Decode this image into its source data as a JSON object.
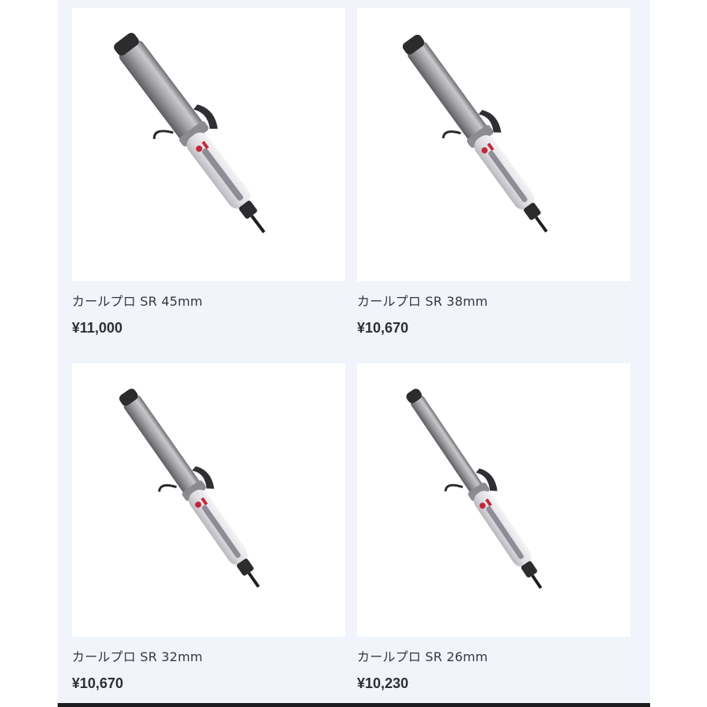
{
  "products": [
    {
      "name": "カールプロ SR 45mm",
      "price": "¥11,000",
      "image": "curling-iron-45mm"
    },
    {
      "name": "カールプロ SR 38mm",
      "price": "¥10,670",
      "image": "curling-iron-38mm"
    },
    {
      "name": "カールプロ SR 32mm",
      "price": "¥10,670",
      "image": "curling-iron-32mm"
    },
    {
      "name": "カールプロ SR 26mm",
      "price": "¥10,230",
      "image": "curling-iron-26mm"
    }
  ],
  "colors": {
    "page_background": "#f1f4fb",
    "card_background": "#ffffff",
    "barrel": "#a9a9ab",
    "handle": "#e6e4e8",
    "accent_red": "#c0283a",
    "cap": "#2c2c2e"
  }
}
